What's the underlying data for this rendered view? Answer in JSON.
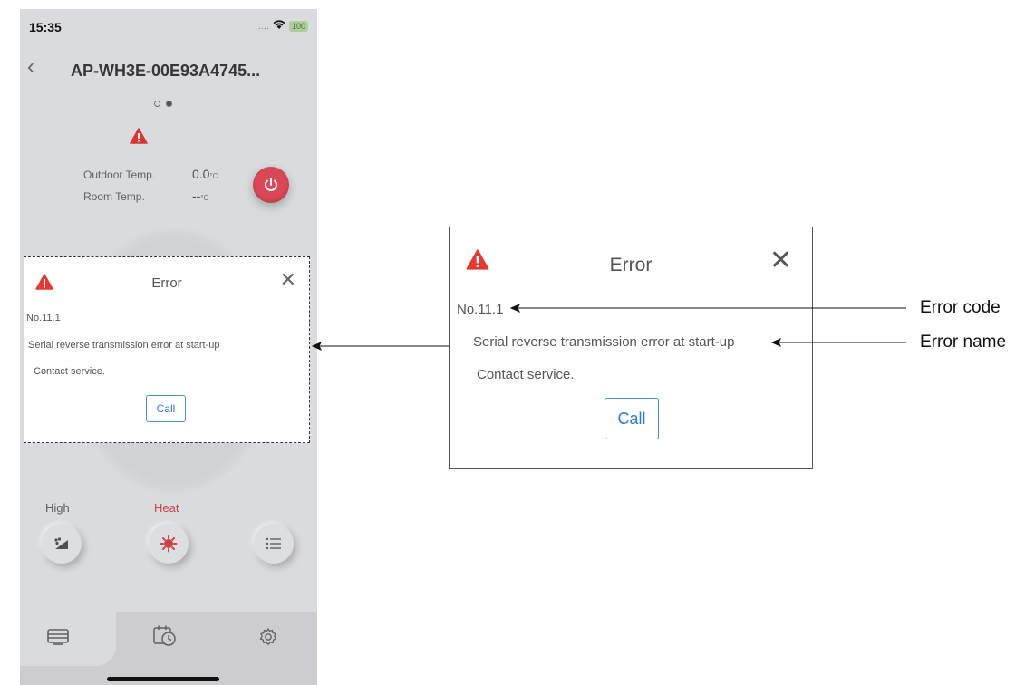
{
  "status_bar": {
    "time": "15:35",
    "signal": "....",
    "battery": "100"
  },
  "header": {
    "device_name": "AP-WH3E-00E93A4745..."
  },
  "temps": {
    "outdoor_label": "Outdoor Temp.",
    "outdoor_value": "0.0",
    "room_label": "Room Temp.",
    "room_value": "--",
    "unit": "°C"
  },
  "modes": {
    "fan_label": "High",
    "mode_label": "Heat"
  },
  "dialog": {
    "title": "Error",
    "error_code": "No.11.1",
    "error_name": "Serial reverse transmission error at start-up",
    "service_text": "Contact service.",
    "call_label": "Call"
  },
  "annotations": {
    "code": "Error code",
    "name": "Error name"
  },
  "colors": {
    "warning": "#e53935",
    "power": "#e64b5b",
    "heat": "#d94848",
    "call": "#2f7bd1"
  },
  "icons": [
    "back-icon",
    "wifi-icon",
    "warning-icon",
    "power-icon",
    "fan-icon",
    "heat-icon",
    "menu-icon",
    "device-tab-icon",
    "schedule-tab-icon",
    "settings-tab-icon",
    "close-icon"
  ]
}
